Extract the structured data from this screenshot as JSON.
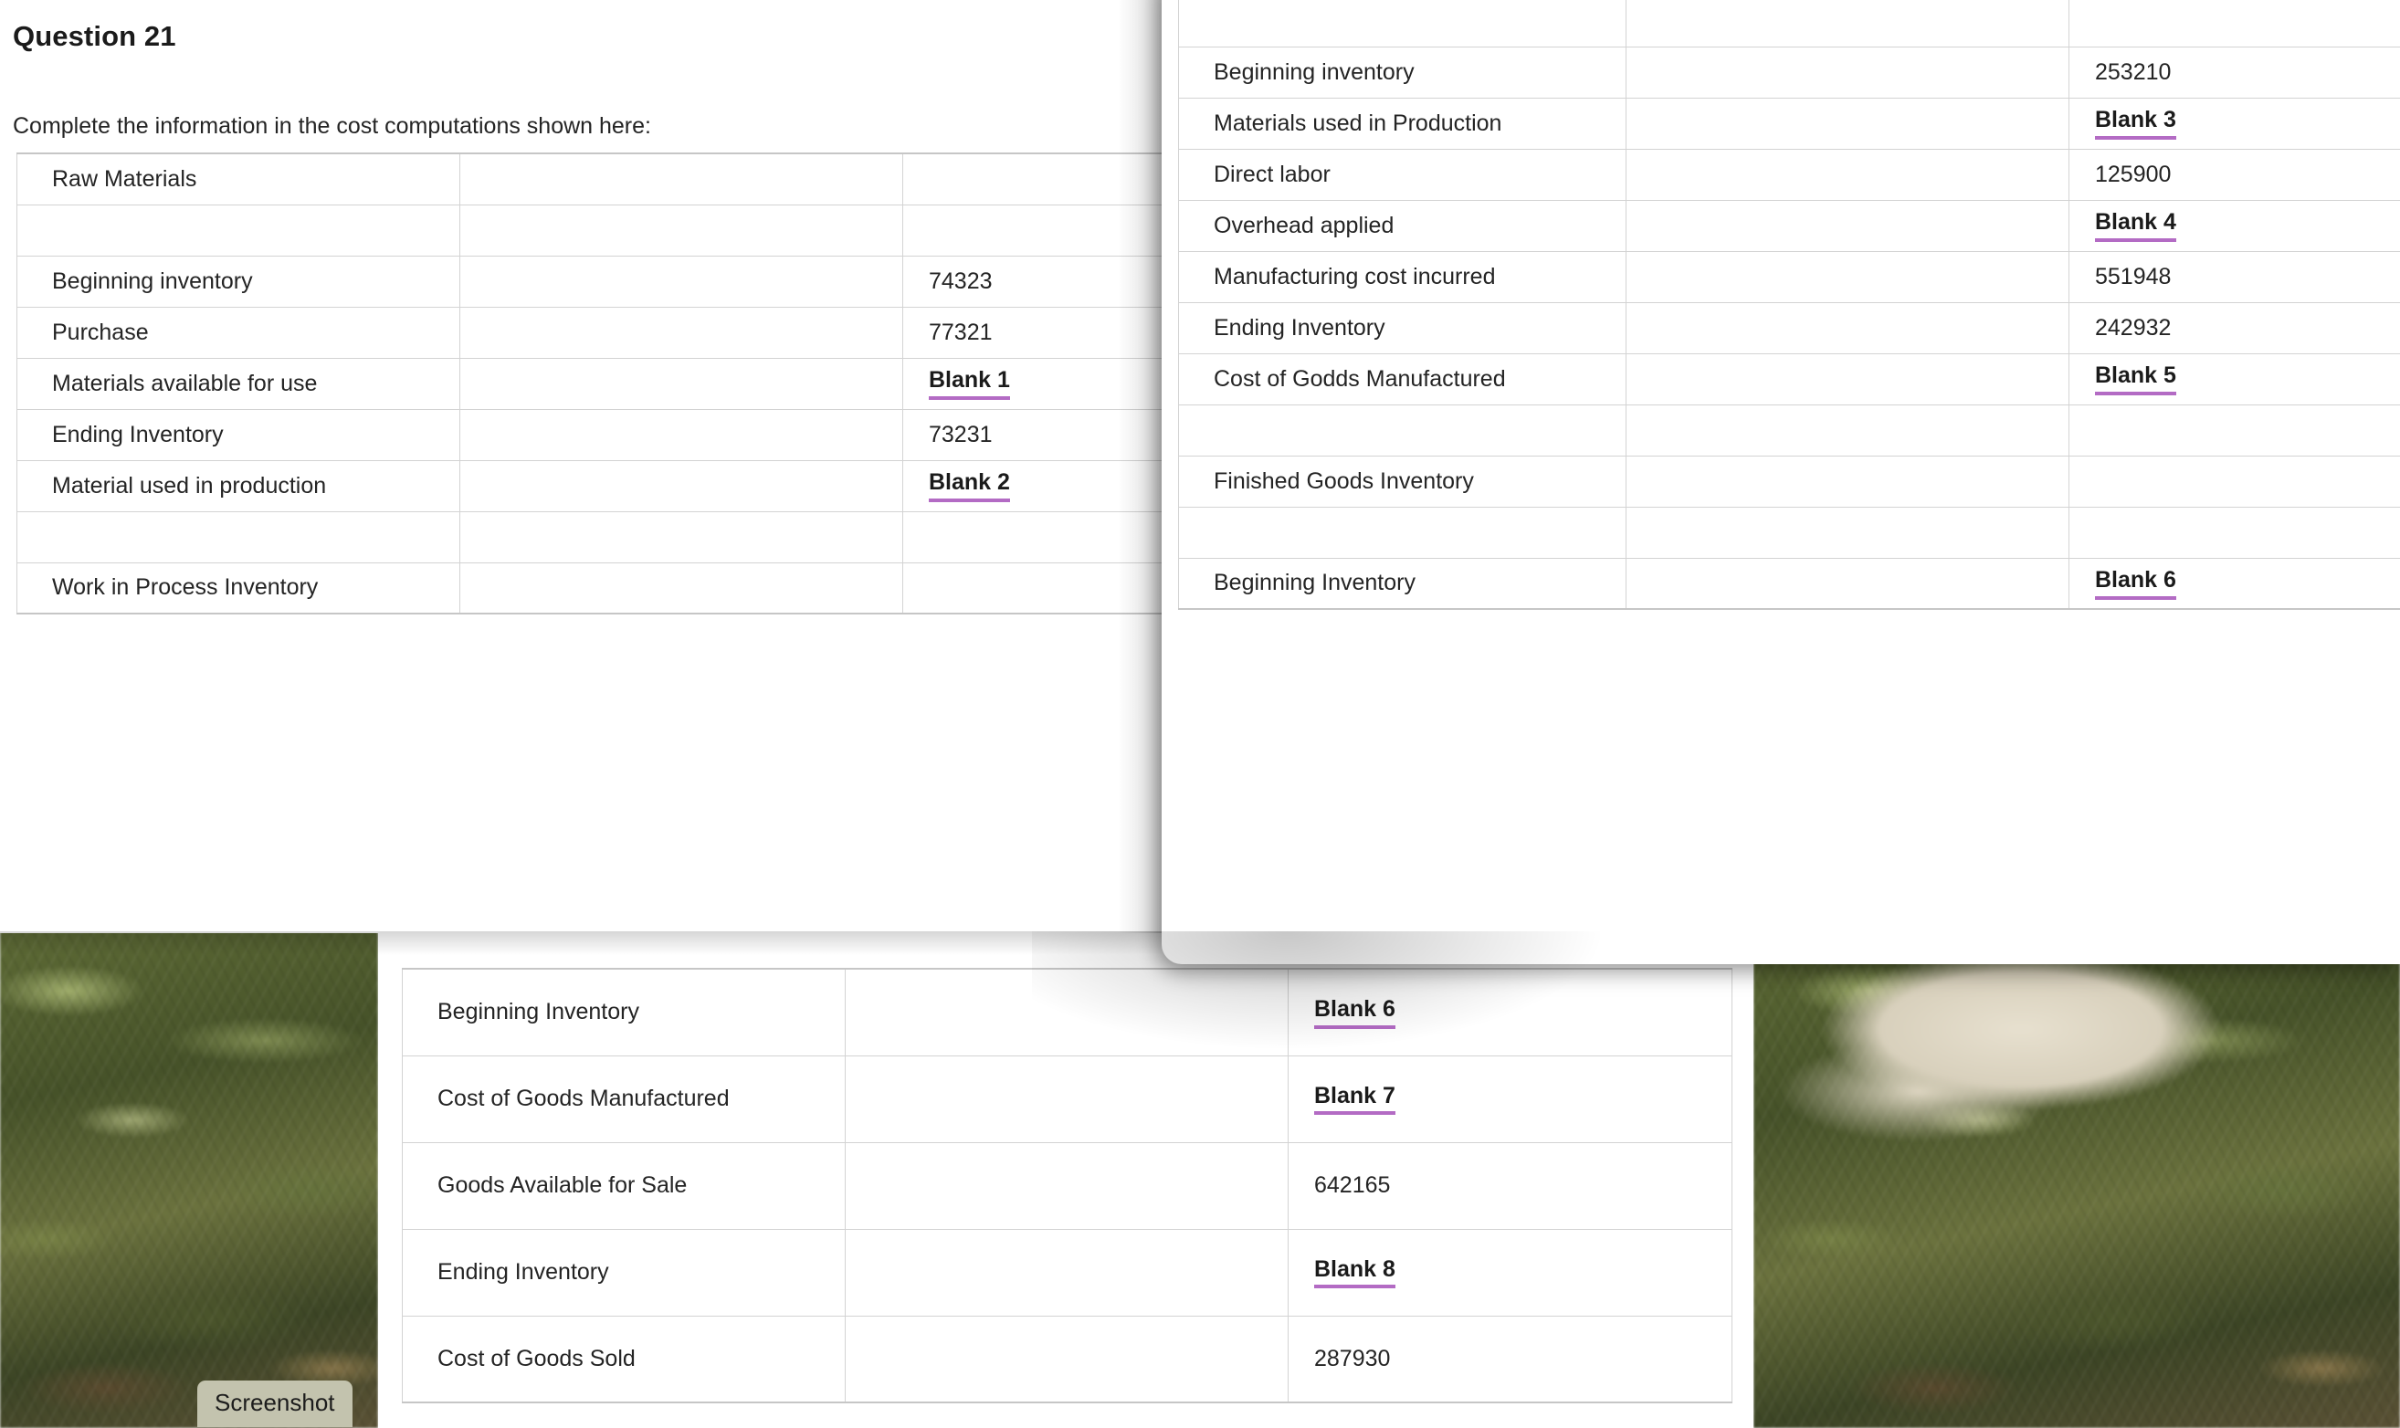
{
  "question": {
    "title": "Question 21",
    "prompt": "Complete the information in the cost computations shown here:"
  },
  "colors": {
    "blank_underline": "#b36bc4",
    "table_border": "#d3d3d3",
    "text": "#242424",
    "toast_background": "#c3c3ae"
  },
  "table_raw_materials": {
    "rows": [
      {
        "label": "Raw Materials",
        "middle": "",
        "value": "",
        "is_blank": false
      },
      {
        "label": "",
        "middle": "",
        "value": "",
        "is_blank": false
      },
      {
        "label": "Beginning inventory",
        "middle": "",
        "value": "74323",
        "is_blank": false
      },
      {
        "label": "Purchase",
        "middle": "",
        "value": "77321",
        "is_blank": false
      },
      {
        "label": "Materials available for use",
        "middle": "",
        "value": "Blank 1",
        "is_blank": true
      },
      {
        "label": "Ending Inventory",
        "middle": "",
        "value": "73231",
        "is_blank": false
      },
      {
        "label": "Material used in production",
        "middle": "",
        "value": "Blank 2",
        "is_blank": true
      },
      {
        "label": "",
        "middle": "",
        "value": "",
        "is_blank": false
      },
      {
        "label": "Work in Process Inventory",
        "middle": "",
        "value": "",
        "is_blank": false
      }
    ]
  },
  "table_work_in_process": {
    "rows": [
      {
        "label": "",
        "middle": "",
        "value": "",
        "is_blank": false
      },
      {
        "label": "Beginning inventory",
        "middle": "",
        "value": "253210",
        "is_blank": false
      },
      {
        "label": "Materials used in Production",
        "middle": "",
        "value": "Blank 3",
        "is_blank": true
      },
      {
        "label": "Direct labor",
        "middle": "",
        "value": "125900",
        "is_blank": false
      },
      {
        "label": "Overhead applied",
        "middle": "",
        "value": "Blank 4",
        "is_blank": true
      },
      {
        "label": "Manufacturing cost incurred",
        "middle": "",
        "value": "551948",
        "is_blank": false
      },
      {
        "label": "Ending Inventory",
        "middle": "",
        "value": "242932",
        "is_blank": false
      },
      {
        "label": "Cost of Godds Manufactured",
        "middle": "",
        "value": "Blank 5",
        "is_blank": true
      },
      {
        "label": "",
        "middle": "",
        "value": "",
        "is_blank": false
      },
      {
        "label": "Finished Goods Inventory",
        "middle": "",
        "value": "",
        "is_blank": false
      },
      {
        "label": "",
        "middle": "",
        "value": "",
        "is_blank": false
      },
      {
        "label": "Beginning Inventory",
        "middle": "",
        "value": "Blank 6",
        "is_blank": true
      }
    ]
  },
  "table_finished_goods": {
    "rows": [
      {
        "label": "Beginning Inventory",
        "middle": "",
        "value": "Blank 6",
        "is_blank": true
      },
      {
        "label": "Cost of Goods Manufactured",
        "middle": "",
        "value": "Blank 7",
        "is_blank": true
      },
      {
        "label": "Goods Available for Sale",
        "middle": "",
        "value": "642165",
        "is_blank": false
      },
      {
        "label": "Ending Inventory",
        "middle": "",
        "value": "Blank 8",
        "is_blank": true
      },
      {
        "label": "Cost of Goods Sold",
        "middle": "",
        "value": "287930",
        "is_blank": false
      }
    ]
  },
  "toast": {
    "label": "Screenshot"
  }
}
